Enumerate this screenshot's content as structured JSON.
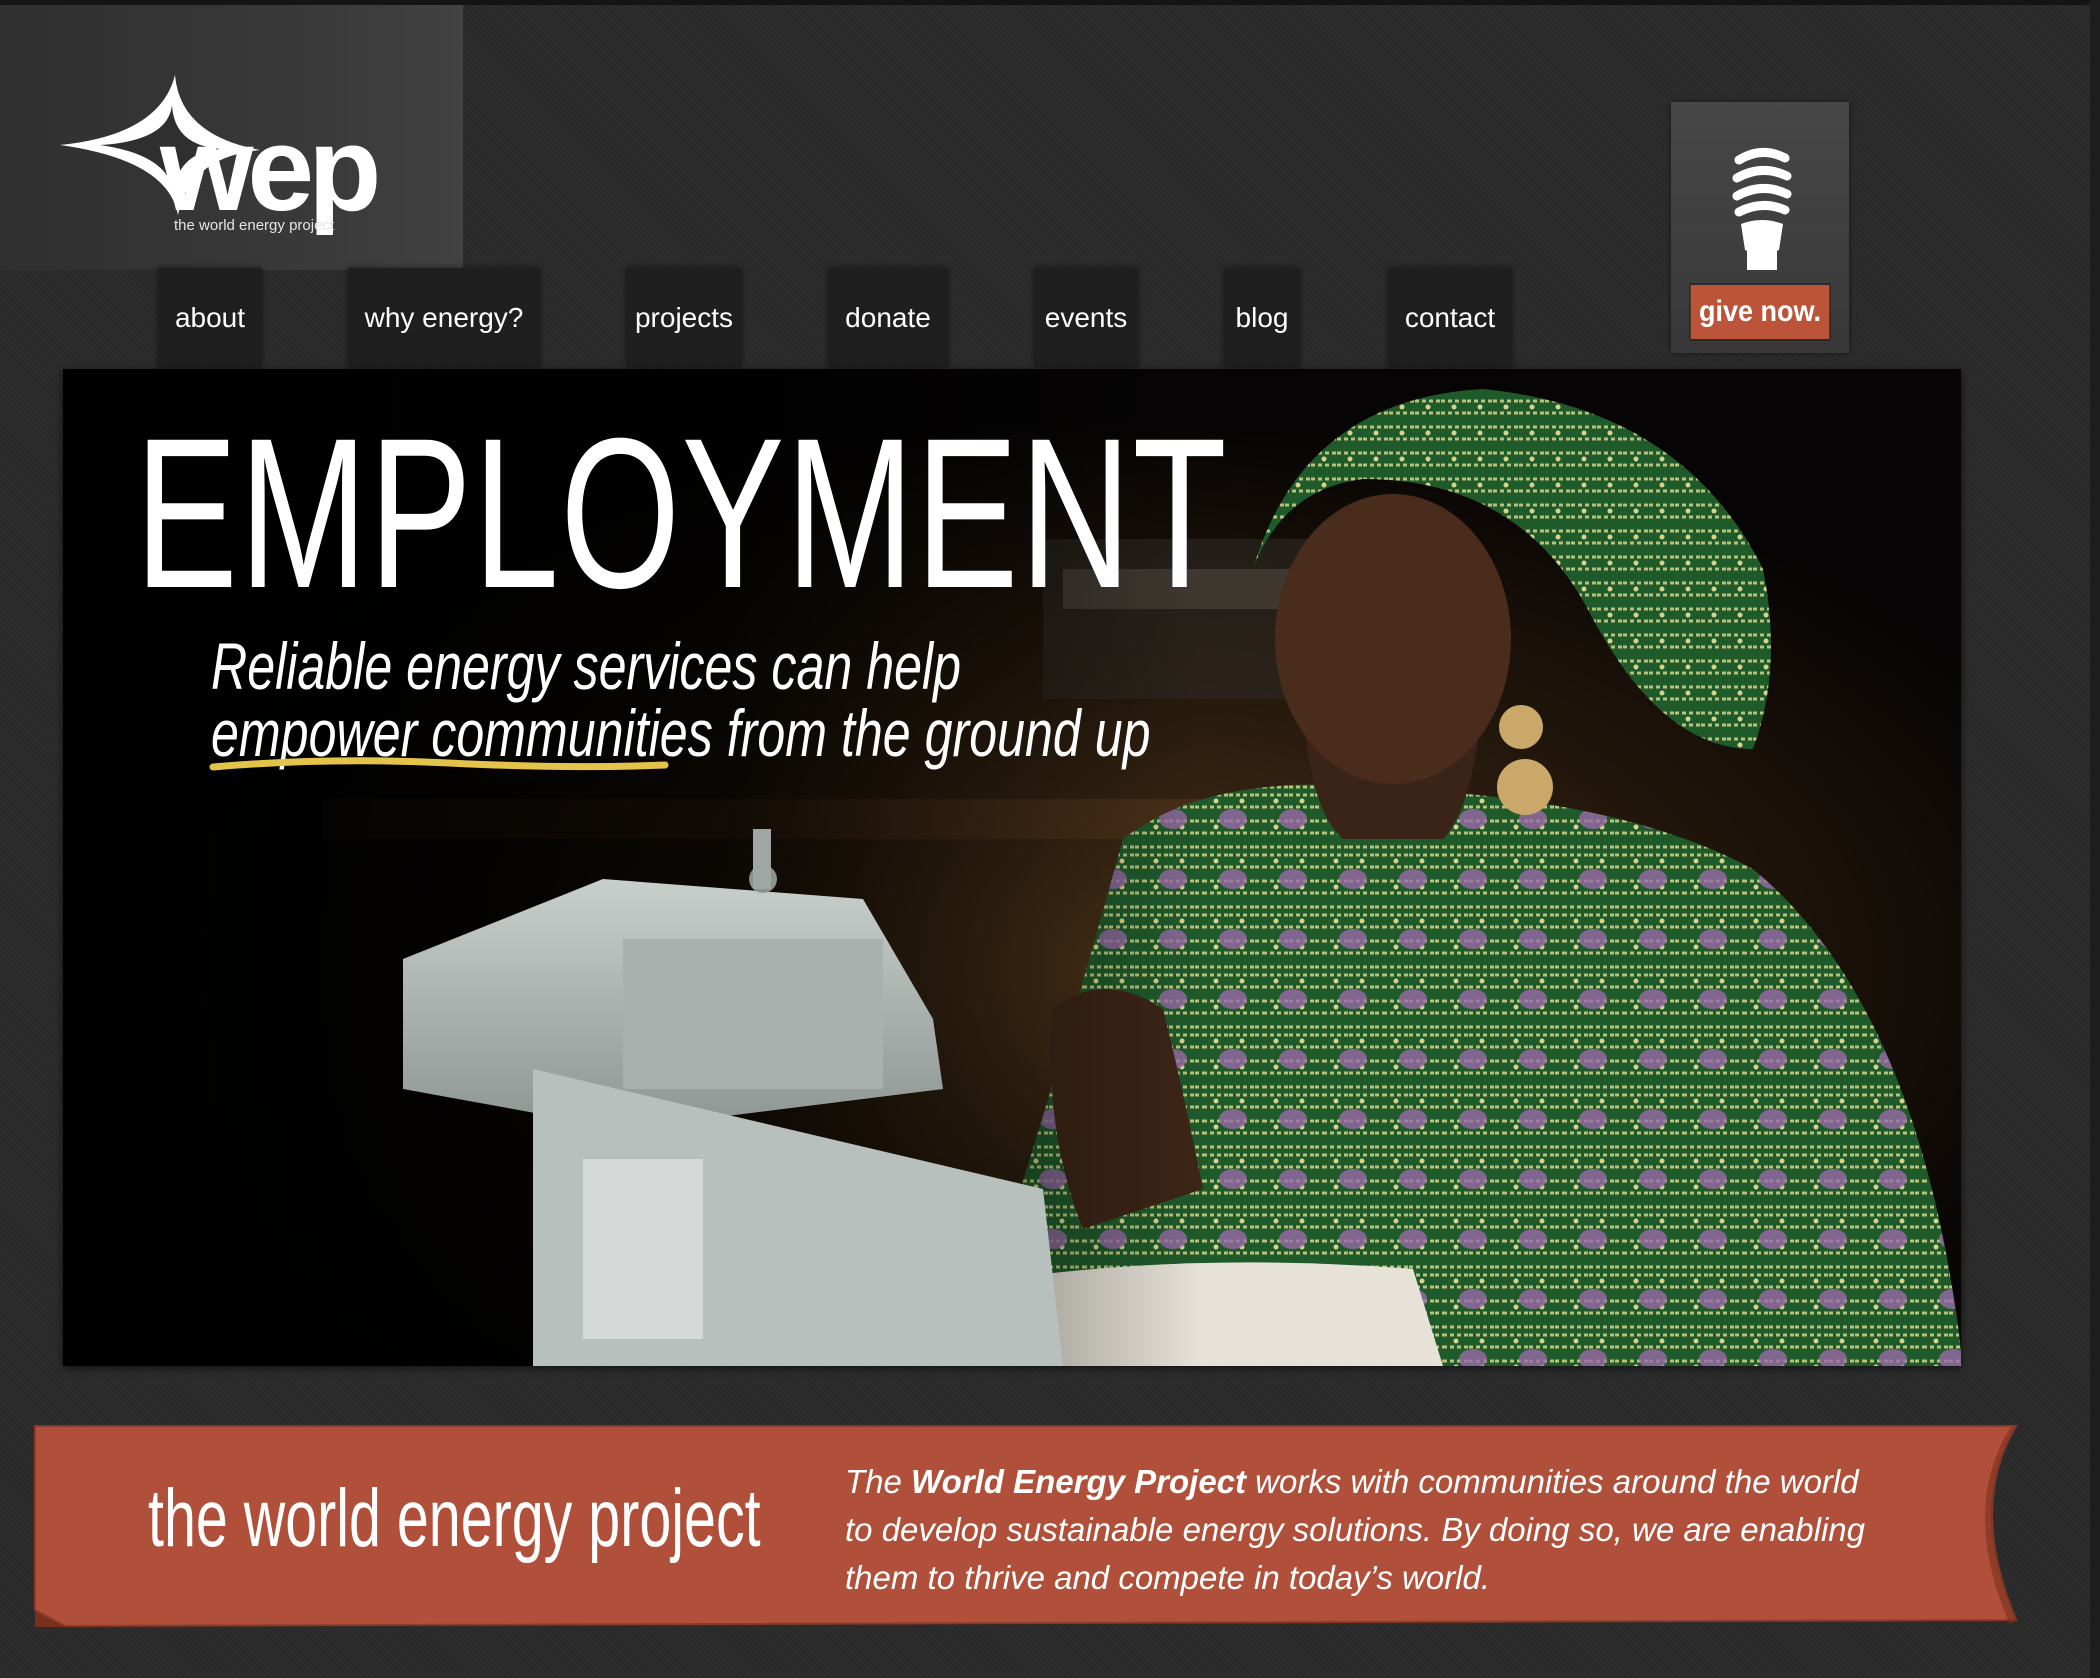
{
  "logo": {
    "wordmark": "wep",
    "tagline": "the world energy project"
  },
  "nav": {
    "items": [
      {
        "label": "about"
      },
      {
        "label": "why energy?"
      },
      {
        "label": "projects"
      },
      {
        "label": "donate"
      },
      {
        "label": "events"
      },
      {
        "label": "blog"
      },
      {
        "label": "contact"
      }
    ]
  },
  "give": {
    "label": "give now."
  },
  "hero": {
    "headline": "EMPLOYMENT",
    "subline_1": "Reliable energy services can help",
    "subline_2_underlined": "empower communities",
    "subline_2_rest": " from the ground up"
  },
  "ribbon": {
    "title": "the world energy project",
    "text_1": "The ",
    "text_bold": "World Energy Project",
    "text_2": " works with communities around the world to develop sustainable energy solutions. By doing so, we are enabling them to thrive and compete in today’s world."
  },
  "colors": {
    "page_bg": "#2b2b2b",
    "nav_bg": "#1f1f1f",
    "accent": "#bb5438",
    "underline": "#e3c34a"
  },
  "icons": {
    "logo": "star-burst-logo-icon",
    "give": "light-bulb-icon"
  }
}
